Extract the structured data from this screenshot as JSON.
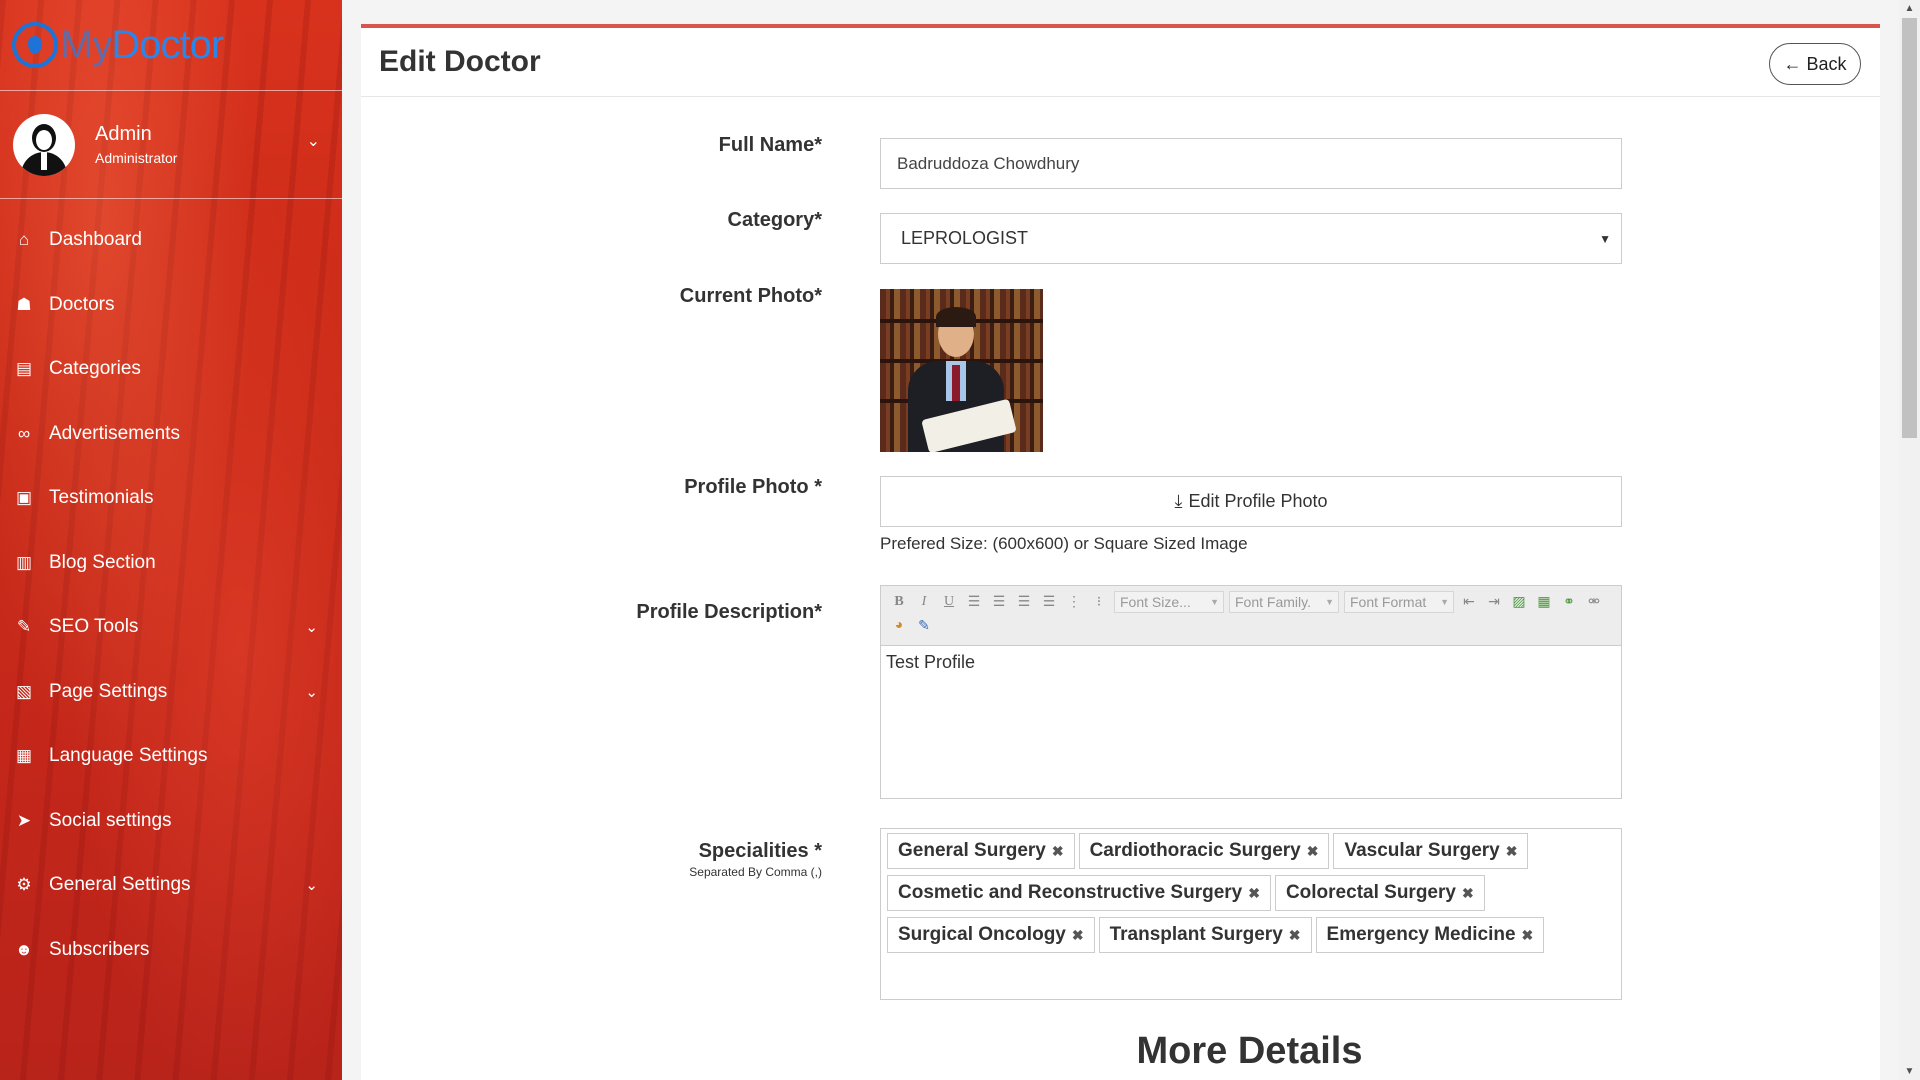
{
  "brand": {
    "logo_my": "My",
    "logo_doctor": "Doctor"
  },
  "user": {
    "name": "Admin",
    "role": "Administrator"
  },
  "sidebar": {
    "items": [
      {
        "label": "Dashboard",
        "icon": "home-icon",
        "glyph": "⌂",
        "has_caret": false
      },
      {
        "label": "Doctors",
        "icon": "user-md-icon",
        "glyph": "☗",
        "has_caret": false
      },
      {
        "label": "Categories",
        "icon": "clipboard-icon",
        "glyph": "▤",
        "has_caret": false
      },
      {
        "label": "Advertisements",
        "icon": "link-icon",
        "glyph": "∞",
        "has_caret": false
      },
      {
        "label": "Testimonials",
        "icon": "image-icon",
        "glyph": "▣",
        "has_caret": false
      },
      {
        "label": "Blog Section",
        "icon": "file-icon",
        "glyph": "▥",
        "has_caret": false
      },
      {
        "label": "SEO Tools",
        "icon": "wrench-icon",
        "glyph": "✎",
        "has_caret": true
      },
      {
        "label": "Page Settings",
        "icon": "file-code-icon",
        "glyph": "▧",
        "has_caret": true
      },
      {
        "label": "Language Settings",
        "icon": "language-icon",
        "glyph": "▦",
        "has_caret": false
      },
      {
        "label": "Social settings",
        "icon": "paper-plane-icon",
        "glyph": "➤",
        "has_caret": false
      },
      {
        "label": "General Settings",
        "icon": "cogs-icon",
        "glyph": "⚙",
        "has_caret": true
      },
      {
        "label": "Subscribers",
        "icon": "users-icon",
        "glyph": "☻",
        "has_caret": false
      }
    ]
  },
  "header": {
    "title": "Edit Doctor",
    "back_label": "Back"
  },
  "form": {
    "full_name_label": "Full Name*",
    "full_name_value": "Badruddoza Chowdhury",
    "category_label": "Category*",
    "category_value": "LEPROLOGIST",
    "current_photo_label": "Current Photo*",
    "profile_photo_label": "Profile Photo *",
    "profile_photo_button": "Edit Profile Photo",
    "profile_photo_hint": "Prefered Size: (600x600) or Square Sized Image",
    "description_label": "Profile Description*",
    "description_value": "Test Profile",
    "editor_font_size": "Font Size...",
    "editor_font_family": "Font Family.",
    "editor_font_format": "Font Format",
    "specialities_label": "Specialities *",
    "specialities_sublabel": "Separated By Comma (,)",
    "specialities": [
      "General Surgery",
      "Cardiothoracic Surgery",
      "Vascular Surgery",
      "Cosmetic and Reconstructive Surgery",
      "Colorectal Surgery",
      "Surgical Oncology",
      "Transplant Surgery",
      "Emergency Medicine"
    ]
  },
  "more_details_title": "More Details",
  "colors": {
    "sidebar": "#c92a18",
    "accent": "#d9534f",
    "logo_blue": "#2a86e8"
  }
}
